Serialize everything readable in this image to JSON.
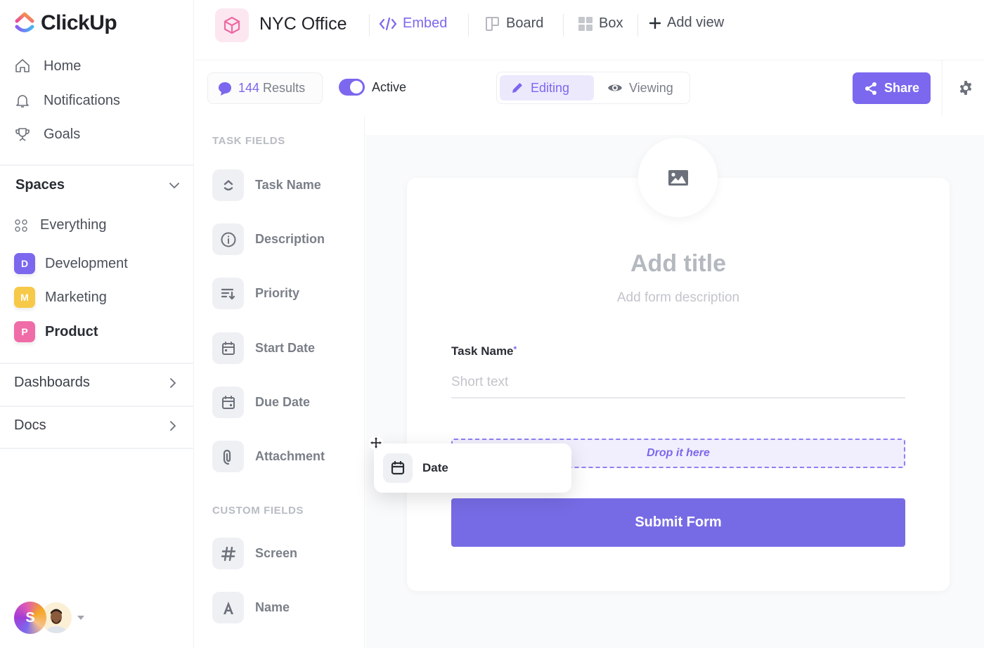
{
  "app": {
    "name": "ClickUp"
  },
  "sidebar": {
    "nav": [
      {
        "label": "Home",
        "icon": "home-icon"
      },
      {
        "label": "Notifications",
        "icon": "bell-icon"
      },
      {
        "label": "Goals",
        "icon": "trophy-icon"
      }
    ],
    "spaces_label": "Spaces",
    "spaces": [
      {
        "label": "Everything",
        "icon": "grid-dots-icon"
      },
      {
        "label": "Development",
        "badge": "D",
        "color": "#7b68ee"
      },
      {
        "label": "Marketing",
        "badge": "M",
        "color": "#f7c948"
      },
      {
        "label": "Product",
        "badge": "P",
        "color": "#ef6ca8",
        "active": true
      }
    ],
    "dashboards_label": "Dashboards",
    "docs_label": "Docs",
    "user_initial": "S"
  },
  "topbar": {
    "project_title": "NYC Office",
    "views": [
      {
        "label": "Embed",
        "icon": "code-icon",
        "active": true
      },
      {
        "label": "Board",
        "icon": "board-icon"
      },
      {
        "label": "Box",
        "icon": "box-grid-icon"
      },
      {
        "label": "Add view",
        "icon": "plus-icon"
      }
    ]
  },
  "toolbar": {
    "results_count": "144",
    "results_label": "Results",
    "toggle_label": "Active",
    "toggle_on": true,
    "mode_editing": "Editing",
    "mode_viewing": "Viewing",
    "share_label": "Share"
  },
  "fields_panel": {
    "task_fields_heading": "TASK FIELDS",
    "task_fields": [
      {
        "label": "Task Name",
        "icon": "task-name-icon"
      },
      {
        "label": "Description",
        "icon": "info-icon"
      },
      {
        "label": "Priority",
        "icon": "priority-icon"
      },
      {
        "label": "Start Date",
        "icon": "calendar-start-icon"
      },
      {
        "label": "Due Date",
        "icon": "calendar-due-icon"
      },
      {
        "label": "Attachment",
        "icon": "paperclip-icon"
      }
    ],
    "custom_fields_heading": "CUSTOM FIELDS",
    "custom_fields": [
      {
        "label": "Screen",
        "icon": "hash-icon"
      },
      {
        "label": "Name",
        "icon": "text-a-icon"
      }
    ]
  },
  "form": {
    "title_placeholder": "Add title",
    "description_placeholder": "Add form description",
    "fields": [
      {
        "label": "Task Name",
        "required_mark": "*",
        "placeholder": "Short text"
      }
    ],
    "drop_zone_label": "Drop it here",
    "submit_label": "Submit Form"
  },
  "drag_ghost": {
    "label": "Date",
    "icon": "calendar-icon"
  },
  "colors": {
    "accent": "#7b68ee",
    "submit": "#776be5",
    "canvas_bg": "#f9fafb"
  }
}
